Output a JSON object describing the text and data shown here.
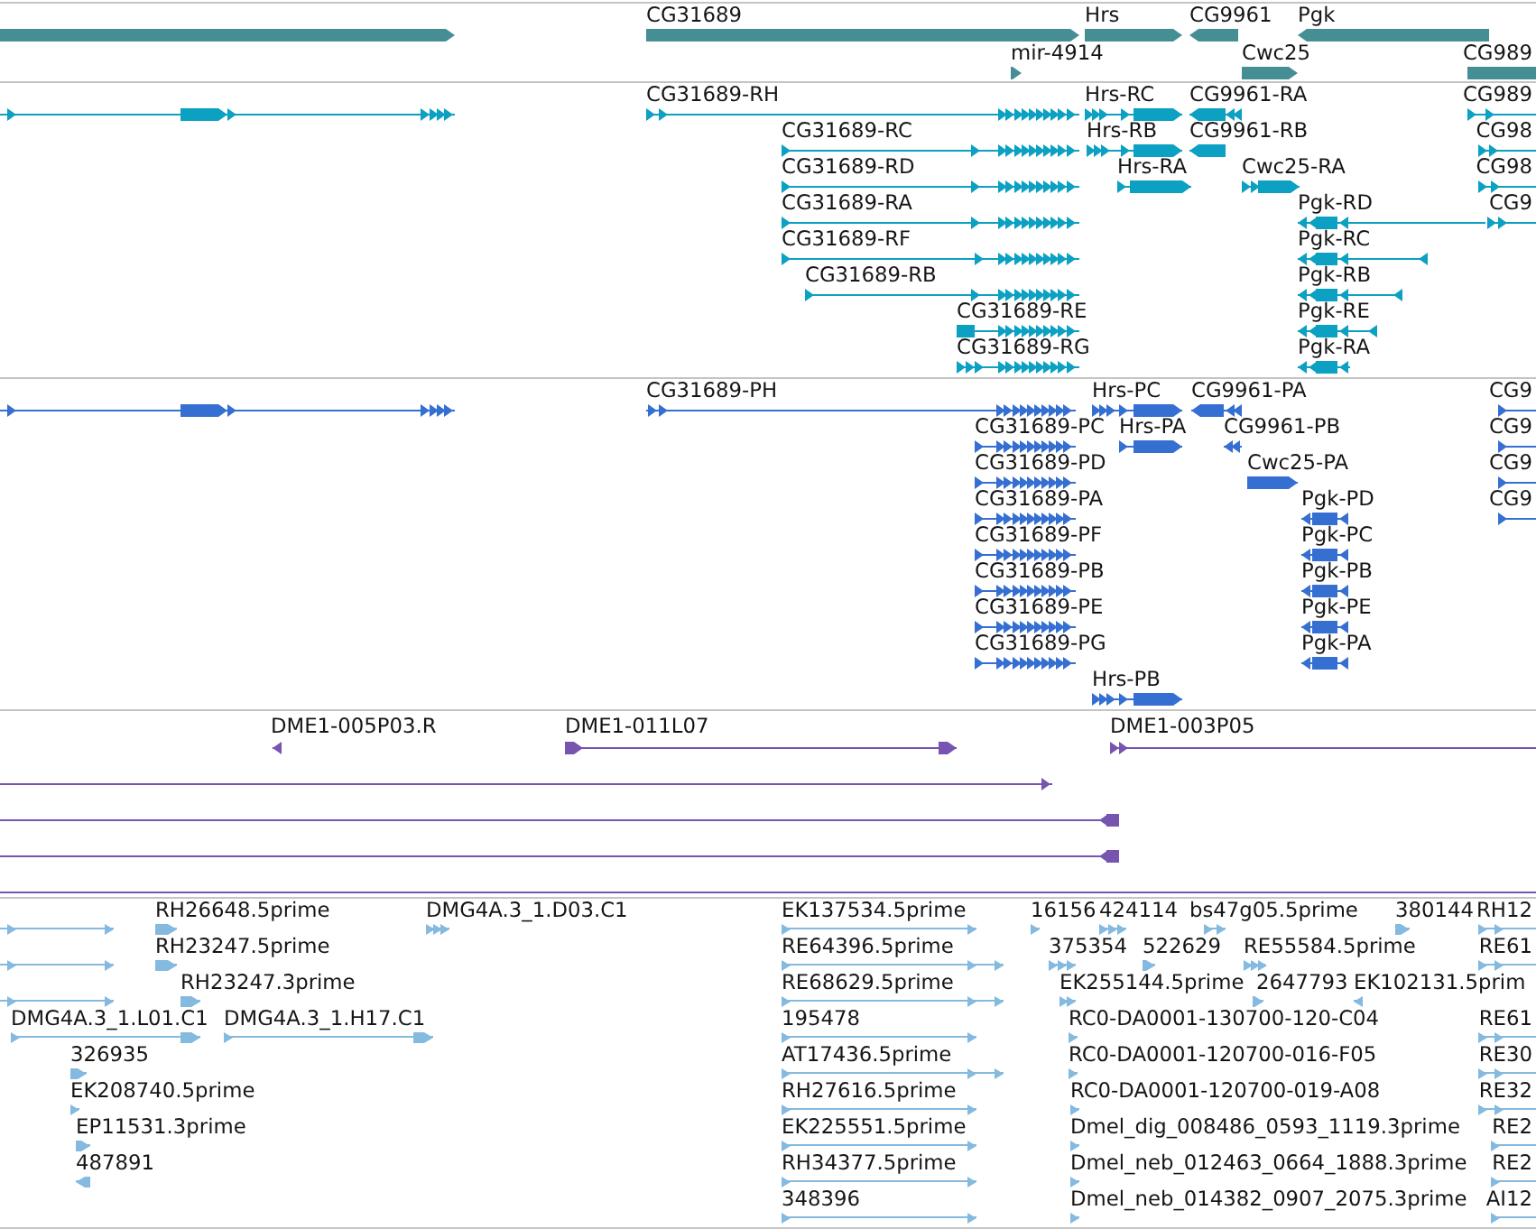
{
  "tracks": [
    {
      "kind": "gene",
      "features": [
        {
          "reverse": false
        },
        {
          "label": "CG31689",
          "reverse": false
        },
        {
          "label": "Hrs",
          "reverse": false
        },
        {
          "label": "CG9961",
          "reverse": true
        },
        {
          "label": "Pgk",
          "reverse": true
        },
        {
          "label": "mir-4914",
          "reverse": false
        },
        {
          "label": "Cwc25",
          "reverse": false
        },
        {
          "label": "CG989"
        }
      ]
    },
    {
      "kind": "transcript",
      "features": [
        {
          "reverse": false
        },
        {
          "label": "CG31689-RH",
          "reverse": false
        },
        {
          "label": "Hrs-RC",
          "reverse": false
        },
        {
          "label": "CG9961-RA",
          "reverse": true
        },
        {
          "label": "CG989",
          "reverse": false
        },
        {
          "label": "CG31689-RC",
          "reverse": false
        },
        {
          "label": "Hrs-RB",
          "reverse": false
        },
        {
          "label": "CG9961-RB",
          "reverse": true
        },
        {
          "label": "CG98",
          "reverse": false
        },
        {
          "label": "CG31689-RD",
          "reverse": false
        },
        {
          "label": "Hrs-RA",
          "reverse": false
        },
        {
          "label": "Cwc25-RA",
          "reverse": false
        },
        {
          "label": "CG98",
          "reverse": false
        },
        {
          "label": "CG31689-RA",
          "reverse": false
        },
        {
          "label": "Pgk-RD",
          "reverse": true
        },
        {
          "label": "CG9",
          "reverse": false
        },
        {
          "label": "CG31689-RF",
          "reverse": false
        },
        {
          "label": "Pgk-RC",
          "reverse": true
        },
        {
          "label": "CG31689-RB",
          "reverse": false
        },
        {
          "label": "Pgk-RB",
          "reverse": true
        },
        {
          "label": "CG31689-RE",
          "reverse": false
        },
        {
          "label": "Pgk-RE",
          "reverse": true
        },
        {
          "label": "CG31689-RG",
          "reverse": false
        },
        {
          "label": "Pgk-RA",
          "reverse": true
        }
      ]
    },
    {
      "kind": "protein",
      "features": [
        {
          "reverse": false
        },
        {
          "label": "CG31689-PH",
          "reverse": false
        },
        {
          "label": "Hrs-PC",
          "reverse": false
        },
        {
          "label": "CG9961-PA",
          "reverse": true
        },
        {
          "label": "CG9",
          "reverse": false
        },
        {
          "label": "CG31689-PC",
          "reverse": false
        },
        {
          "label": "Hrs-PA",
          "reverse": false
        },
        {
          "label": "CG9961-PB",
          "reverse": true
        },
        {
          "label": "CG9",
          "reverse": false
        },
        {
          "label": "CG31689-PD",
          "reverse": false
        },
        {
          "label": "Cwc25-PA",
          "reverse": false
        },
        {
          "label": "CG9",
          "reverse": false
        },
        {
          "label": "CG31689-PA",
          "reverse": false
        },
        {
          "label": "Pgk-PD",
          "reverse": true
        },
        {
          "label": "CG9",
          "reverse": false
        },
        {
          "label": "CG31689-PF",
          "reverse": false
        },
        {
          "label": "Pgk-PC",
          "reverse": true
        },
        {
          "label": "CG31689-PB",
          "reverse": false
        },
        {
          "label": "Pgk-PB",
          "reverse": true
        },
        {
          "label": "CG31689-PE",
          "reverse": false
        },
        {
          "label": "Pgk-PE",
          "reverse": true
        },
        {
          "label": "CG31689-PG",
          "reverse": false
        },
        {
          "label": "Pgk-PA",
          "reverse": true
        },
        {
          "label": "Hrs-PB",
          "reverse": false
        }
      ]
    },
    {
      "kind": "clone",
      "features": [
        {
          "label": "DME1-005P03.R",
          "reverse": true
        },
        {
          "label": "DME1-011L07",
          "reverse": false
        },
        {
          "label": "DME1-003P05",
          "reverse": false
        },
        {
          "reverse": false
        },
        {
          "reverse": true
        },
        {
          "reverse": true
        }
      ]
    },
    {
      "kind": "est",
      "features": [
        {
          "reverse": false
        },
        {
          "label": "RH26648.5prime",
          "reverse": false
        },
        {
          "label": "DMG4A.3_1.D03.C1",
          "reverse": false
        },
        {
          "label": "EK137534.5prime",
          "reverse": false
        },
        {
          "label": "16156",
          "reverse": false
        },
        {
          "label": "424114",
          "reverse": false
        },
        {
          "label": "bs47g05.5prime",
          "reverse": false
        },
        {
          "label": "380144",
          "reverse": false
        },
        {
          "label": "RH12",
          "reverse": false
        },
        {
          "reverse": false
        },
        {
          "label": "RH23247.5prime",
          "reverse": false
        },
        {
          "label": "RE64396.5prime",
          "reverse": false
        },
        {
          "label": "375354",
          "reverse": false
        },
        {
          "label": "522629",
          "reverse": false
        },
        {
          "label": "RE55584.5prime",
          "reverse": false
        },
        {
          "label": "RE61",
          "reverse": false
        },
        {
          "reverse": false
        },
        {
          "label": "RH23247.3prime",
          "reverse": false
        },
        {
          "label": "RE68629.5prime",
          "reverse": false
        },
        {
          "label": "EK255144.5prime",
          "reverse": false
        },
        {
          "label": "2647793",
          "reverse": false
        },
        {
          "label": "EK102131.5prim",
          "reverse": true
        },
        {
          "label": "DMG4A.3_1.L01.C1",
          "reverse": false
        },
        {
          "label": "DMG4A.3_1.H17.C1",
          "reverse": false
        },
        {
          "label": "195478",
          "reverse": false
        },
        {
          "label": "RC0-DA0001-130700-120-C04",
          "reverse": false
        },
        {
          "label": "RE61",
          "reverse": false
        },
        {
          "label": "326935",
          "reverse": false
        },
        {
          "label": "AT17436.5prime",
          "reverse": false
        },
        {
          "label": "RC0-DA0001-120700-016-F05",
          "reverse": false
        },
        {
          "label": "RE30",
          "reverse": false
        },
        {
          "label": "EK208740.5prime",
          "reverse": false
        },
        {
          "label": "RH27616.5prime",
          "reverse": false
        },
        {
          "label": "RC0-DA0001-120700-019-A08",
          "reverse": false
        },
        {
          "label": "RE32",
          "reverse": false
        },
        {
          "label": "EP11531.3prime",
          "reverse": false
        },
        {
          "label": "EK225551.5prime",
          "reverse": false
        },
        {
          "label": "Dmel_dig_008486_0593_1119.3prime",
          "reverse": false
        },
        {
          "label": "RE2",
          "reverse": false
        },
        {
          "label": "487891",
          "reverse": true
        },
        {
          "label": "RH34377.5prime",
          "reverse": false
        },
        {
          "label": "Dmel_neb_012463_0664_1888.3prime",
          "reverse": false
        },
        {
          "label": "RE2",
          "reverse": false
        },
        {
          "label": "348396",
          "reverse": false
        },
        {
          "label": "Dmel_neb_014382_0907_2075.3prime",
          "reverse": false
        },
        {
          "label": "AI12",
          "reverse": false
        }
      ]
    }
  ]
}
